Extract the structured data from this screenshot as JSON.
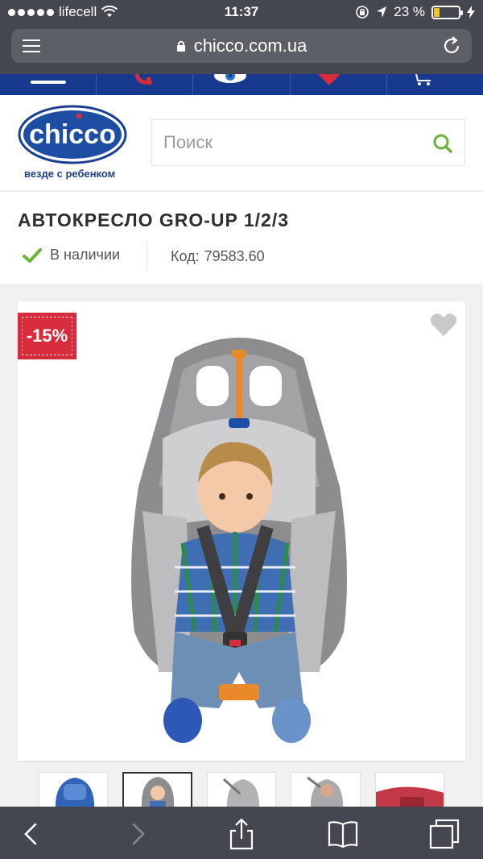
{
  "status_bar": {
    "carrier": "lifecell",
    "time": "11:37",
    "battery_percent": "23 %",
    "battery_level": 0.23
  },
  "browser": {
    "url": "chicco.com.ua"
  },
  "header": {
    "logo_text": "chicco",
    "tagline": "везде с ребенком",
    "search_placeholder": "Поиск"
  },
  "product": {
    "title": "АВТОКРЕСЛО GRO-UP 1/2/3",
    "availability": "В наличии",
    "code_label": "Код:",
    "code_value": "79583.60",
    "discount_badge": "-15%"
  },
  "icons": {
    "reader": "reader-icon",
    "reload": "reload-icon",
    "search": "search-icon",
    "heart": "heart-icon",
    "check": "check-icon",
    "back": "back-icon",
    "forward": "forward-icon",
    "share": "share-icon",
    "bookmarks": "bookmarks-icon",
    "tabs": "tabs-icon"
  },
  "colors": {
    "brand_blue": "#173a8e",
    "discount_red": "#d82c3c",
    "check_green": "#6bb33b",
    "search_green": "#6bb33b"
  }
}
